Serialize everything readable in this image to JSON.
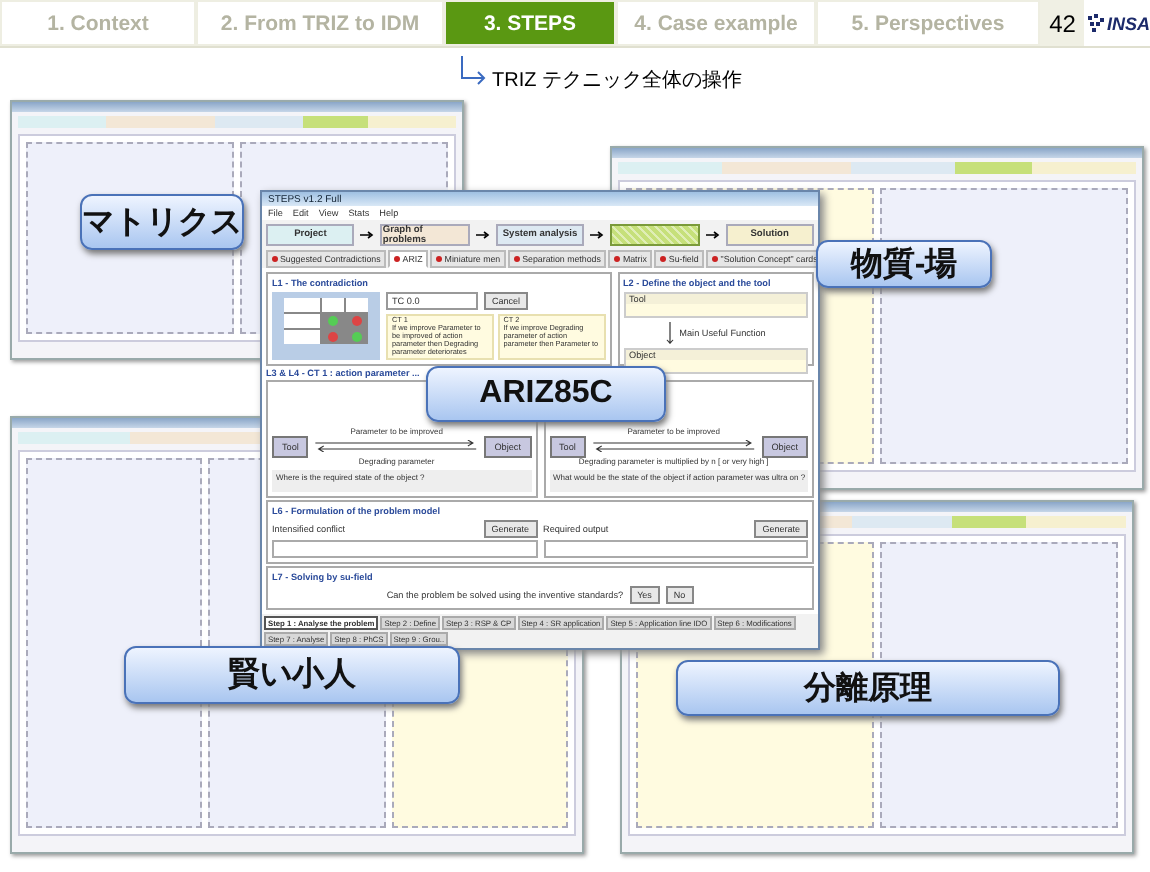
{
  "nav": {
    "tabs": [
      {
        "label": "1. Context",
        "selected": false
      },
      {
        "label": "2. From TRIZ to IDM",
        "selected": false
      },
      {
        "label": "3. STEPS",
        "selected": true
      },
      {
        "label": "4. Case example",
        "selected": false
      },
      {
        "label": "5. Perspectives",
        "selected": false
      }
    ],
    "page_number": "42",
    "logo_text": "INSA"
  },
  "subtitle": "TRIZ テクニック全体の操作",
  "ariz_window": {
    "title": "STEPS v1.2 Full",
    "menu": [
      "File",
      "Edit",
      "View",
      "Stats",
      "Help"
    ],
    "steps": [
      {
        "label": "Project",
        "color": "#dcf0f2",
        "selected": false
      },
      {
        "label": "Graph of problems",
        "color": "#f3e7d6",
        "selected": false
      },
      {
        "label": "System analysis",
        "color": "#dde9f2",
        "selected": false
      },
      {
        "color": "#c6e07a",
        "selected": true
      },
      {
        "label": "Solution",
        "color": "#f6f0cf",
        "selected": false
      }
    ],
    "tabs": [
      {
        "label": "Suggested Contradictions",
        "selected": false
      },
      {
        "label": "ARIZ",
        "selected": true
      },
      {
        "label": "Miniature men",
        "selected": false
      },
      {
        "label": "Separation methods",
        "selected": false
      },
      {
        "label": "Matrix",
        "selected": false
      },
      {
        "label": "Su-field",
        "selected": false
      },
      {
        "label": "\"Solution Concept\" cards",
        "selected": false
      }
    ],
    "l1_title": "L1 - The contradiction",
    "tc_select": "TC 0.0",
    "cancel": "Cancel",
    "ct_notes": [
      {
        "title": "CT 1",
        "text": "If we improve Parameter to be improved of action parameter then Degrading parameter deteriorates"
      },
      {
        "title": "CT 2",
        "text": "If we improve Degrading parameter of action parameter then Parameter to"
      }
    ],
    "l2_title": "L2 - Define the object and the tool",
    "tool": "Tool",
    "object": "Object",
    "muf": "Main Useful Function",
    "l3_title": "L3 & L4 - CT 1 : action parameter ...",
    "l3_left": {
      "tool": "Tool",
      "object": "Object",
      "top": "Parameter to be improved",
      "bottom": "Degrading parameter",
      "question": "Where is the required state of the object ?"
    },
    "l3_right": {
      "tool": "Tool",
      "object": "Object",
      "top": "Parameter to be improved",
      "bottom": "Degrading parameter is multiplied by n [ or very high ]",
      "question": "What would be the state of the object if action parameter was ultra on ?"
    },
    "l6_title": "L6 - Formulation of the problem model",
    "intensified": "Intensified conflict",
    "required": "Required output",
    "generate": [
      "Generate",
      "Generate"
    ],
    "l7_title": "L7 - Solving by su-field",
    "l7_question": "Can the problem be solved using the inventive standards?",
    "answers": [
      "Yes",
      "No"
    ],
    "bottom_tabs": [
      {
        "label": "Step 1 : Analyse the problem",
        "selected": true
      },
      {
        "label": "Step 2 : Define",
        "selected": false
      },
      {
        "label": "Step 3 : RSP & CP",
        "selected": false
      },
      {
        "label": "Step 4 : SR application",
        "selected": false
      },
      {
        "label": "Step 5 : Application line IDO",
        "selected": false
      },
      {
        "label": "Step 6 : Modifications",
        "selected": false
      },
      {
        "label": "Step 7 : Analyse",
        "selected": false
      },
      {
        "label": "Step 8 : PhCS",
        "selected": false
      },
      {
        "label": "Step 9 : Grou..",
        "selected": false
      }
    ]
  },
  "callouts": [
    "マトリクス",
    "ARIZ85C",
    "物質-場",
    "賢い小人",
    "分離原理"
  ]
}
